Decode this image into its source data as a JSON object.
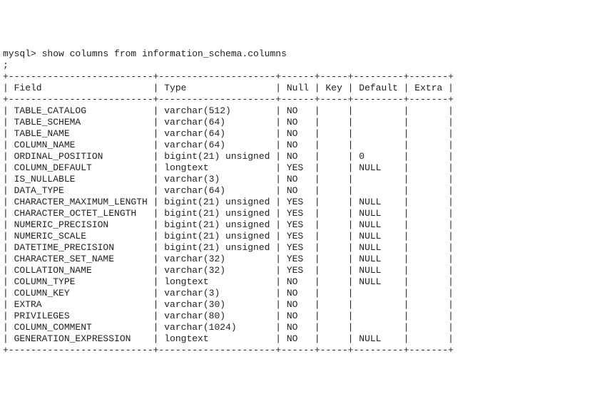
{
  "prompt": "mysql> show columns from information_schema.columns",
  "continuation": ";",
  "chart_data": {
    "type": "table",
    "columns": [
      "Field",
      "Type",
      "Null",
      "Key",
      "Default",
      "Extra"
    ],
    "rows": [
      {
        "field": "TABLE_CATALOG",
        "type": "varchar(512)",
        "null": "NO",
        "key": "",
        "default": "",
        "extra": ""
      },
      {
        "field": "TABLE_SCHEMA",
        "type": "varchar(64)",
        "null": "NO",
        "key": "",
        "default": "",
        "extra": ""
      },
      {
        "field": "TABLE_NAME",
        "type": "varchar(64)",
        "null": "NO",
        "key": "",
        "default": "",
        "extra": ""
      },
      {
        "field": "COLUMN_NAME",
        "type": "varchar(64)",
        "null": "NO",
        "key": "",
        "default": "",
        "extra": ""
      },
      {
        "field": "ORDINAL_POSITION",
        "type": "bigint(21) unsigned",
        "null": "NO",
        "key": "",
        "default": "0",
        "extra": ""
      },
      {
        "field": "COLUMN_DEFAULT",
        "type": "longtext",
        "null": "YES",
        "key": "",
        "default": "NULL",
        "extra": ""
      },
      {
        "field": "IS_NULLABLE",
        "type": "varchar(3)",
        "null": "NO",
        "key": "",
        "default": "",
        "extra": ""
      },
      {
        "field": "DATA_TYPE",
        "type": "varchar(64)",
        "null": "NO",
        "key": "",
        "default": "",
        "extra": ""
      },
      {
        "field": "CHARACTER_MAXIMUM_LENGTH",
        "type": "bigint(21) unsigned",
        "null": "YES",
        "key": "",
        "default": "NULL",
        "extra": ""
      },
      {
        "field": "CHARACTER_OCTET_LENGTH",
        "type": "bigint(21) unsigned",
        "null": "YES",
        "key": "",
        "default": "NULL",
        "extra": ""
      },
      {
        "field": "NUMERIC_PRECISION",
        "type": "bigint(21) unsigned",
        "null": "YES",
        "key": "",
        "default": "NULL",
        "extra": ""
      },
      {
        "field": "NUMERIC_SCALE",
        "type": "bigint(21) unsigned",
        "null": "YES",
        "key": "",
        "default": "NULL",
        "extra": ""
      },
      {
        "field": "DATETIME_PRECISION",
        "type": "bigint(21) unsigned",
        "null": "YES",
        "key": "",
        "default": "NULL",
        "extra": ""
      },
      {
        "field": "CHARACTER_SET_NAME",
        "type": "varchar(32)",
        "null": "YES",
        "key": "",
        "default": "NULL",
        "extra": ""
      },
      {
        "field": "COLLATION_NAME",
        "type": "varchar(32)",
        "null": "YES",
        "key": "",
        "default": "NULL",
        "extra": ""
      },
      {
        "field": "COLUMN_TYPE",
        "type": "longtext",
        "null": "NO",
        "key": "",
        "default": "NULL",
        "extra": ""
      },
      {
        "field": "COLUMN_KEY",
        "type": "varchar(3)",
        "null": "NO",
        "key": "",
        "default": "",
        "extra": ""
      },
      {
        "field": "EXTRA",
        "type": "varchar(30)",
        "null": "NO",
        "key": "",
        "default": "",
        "extra": ""
      },
      {
        "field": "PRIVILEGES",
        "type": "varchar(80)",
        "null": "NO",
        "key": "",
        "default": "",
        "extra": ""
      },
      {
        "field": "COLUMN_COMMENT",
        "type": "varchar(1024)",
        "null": "NO",
        "key": "",
        "default": "",
        "extra": ""
      },
      {
        "field": "GENERATION_EXPRESSION",
        "type": "longtext",
        "null": "NO",
        "key": "",
        "default": "NULL",
        "extra": ""
      }
    ]
  },
  "widths": {
    "field": 26,
    "type": 21,
    "null": 6,
    "key": 5,
    "default": 9,
    "extra": 7
  }
}
